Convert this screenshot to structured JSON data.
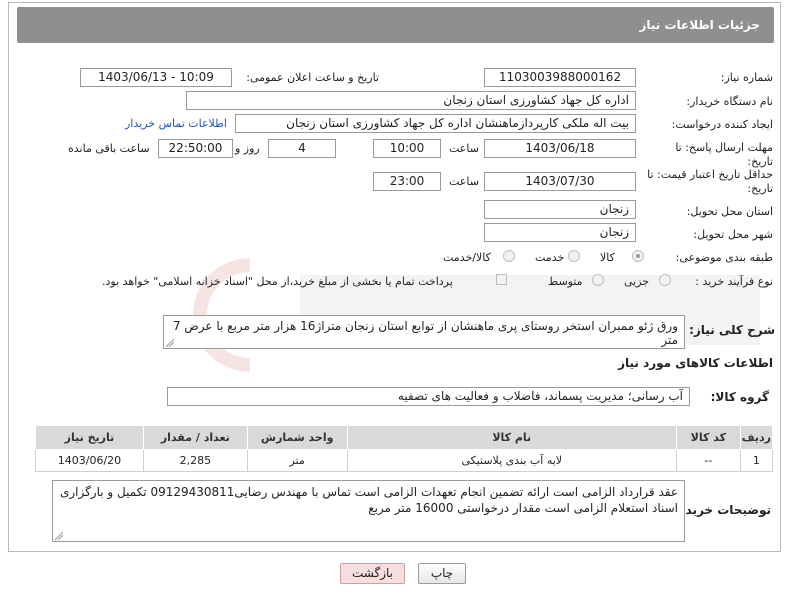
{
  "header": {
    "title": "جزئیات اطلاعات نیاز"
  },
  "fields": {
    "need_number_label": "شماره نیاز:",
    "need_number": "1103003988000162",
    "announce_label": "تاریخ و ساعت اعلان عمومی:",
    "announce_value": "1403/06/13 - 10:09",
    "buyer_org_label": "نام دستگاه خریدار:",
    "buyer_org": "اداره کل جهاد کشاورزی استان زنجان",
    "creator_label": "ایجاد کننده درخواست:",
    "creator": "بیت اله ملکی کارپردازماهنشان اداره کل جهاد کشاورزی استان زنجان",
    "contact_link": "اطلاعات تماس خریدار",
    "deadline_label": "مهلت ارسال پاسخ: تا تاریخ:",
    "deadline_date": "1403/06/18",
    "time_label": "ساعت",
    "deadline_time": "10:00",
    "days_value": "4",
    "days_label": "روز و",
    "remaining_time": "22:50:00",
    "remaining_label": "ساعت باقی مانده",
    "validity_label": "حداقل تاریخ اعتبار قیمت: تا تاریخ:",
    "validity_date": "1403/07/30",
    "validity_time": "23:00",
    "province_label": "استان محل تحویل:",
    "province": "زنجان",
    "city_label": "شهر محل تحویل:",
    "city": "زنجان",
    "category_label": "طبقه بندی موضوعی:",
    "category_options": [
      "کالا",
      "خدمت",
      "کالا/خدمت"
    ],
    "process_label": "نوع فرآیند خرید :",
    "process_options": [
      "جزیی",
      "متوسط"
    ],
    "payment_note": "پرداخت تمام یا بخشی از مبلغ خرید،از محل \"اسناد خزانه اسلامی\" خواهد بود."
  },
  "description": {
    "label": "شرح کلی نیاز:",
    "text": "ورق ژئو ممبران استخر روستای پری ماهنشان از توابع استان زنجان متراژ16 هزار متر مربع با عرض 7 متر"
  },
  "goods": {
    "section_title": "اطلاعات کالاهای مورد نیاز",
    "group_label": "گروه کالا:",
    "group_value": "آب رسانی؛ مدیریت پسماند، فاضلاب و فعالیت های تصفیه",
    "columns": [
      "ردیف",
      "کد کالا",
      "نام کالا",
      "واحد شمارش",
      "تعداد / مقدار",
      "تاریخ نیاز"
    ],
    "rows": [
      {
        "row": "1",
        "code": "--",
        "name": "لایه آب بندی پلاستیکی",
        "unit": "متر",
        "qty": "2,285",
        "date": "1403/06/20"
      }
    ]
  },
  "buyer_notes": {
    "label": "توضیحات خریدار:",
    "text": "عقد قرارداد الزامی است ارائه تضمین انجام تعهدات الزامی است تماس با مهندس رضایی09129430811 تکمیل و بارگزاری اسناد استعلام الزامی است مقدار درخواستی 16000 متر مربع"
  },
  "buttons": {
    "print": "چاپ",
    "back": "بازگشت"
  },
  "colors": {
    "header_bg": "#8f8f8f",
    "link": "#1a56b8",
    "back_button_bg": "#f7dede"
  }
}
